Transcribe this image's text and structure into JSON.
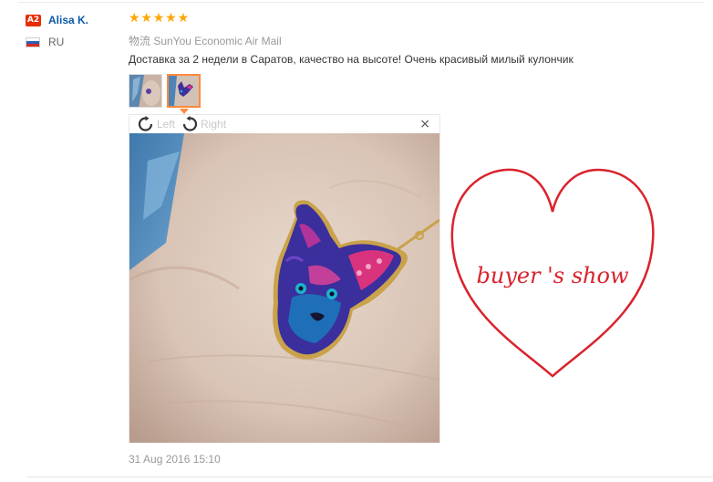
{
  "buyer": {
    "level_badge": "A2",
    "name": "Alisa K.",
    "country_code": "RU",
    "flag_colors": [
      "#ffffff",
      "#2b5fb5",
      "#d52b1e"
    ]
  },
  "feedback": {
    "rating_stars": 5,
    "star_glyph": "★★★★★",
    "shipping": "物流 SunYou Economic Air Mail",
    "text": "Доставка за 2 недели в Саратов, качество на высоте! Очень красивый милый кулончик",
    "thumbnails": [
      "photo-1-thumbnail",
      "photo-2-thumbnail"
    ],
    "active_thumbnail": 2,
    "timestamp": "31 Aug 2016 15:10"
  },
  "viewer": {
    "rotate_left_label": "Left",
    "rotate_right_label": "Right",
    "close_glyph": "×"
  },
  "annotation": {
    "text": "buyer 's show",
    "color": "#d9232d"
  },
  "colors": {
    "name_link": "#0b5ba6",
    "star": "#ffa500",
    "badge": "#e62e04",
    "active_thumb_border": "#ff8a3d",
    "muted_text": "#999999"
  }
}
